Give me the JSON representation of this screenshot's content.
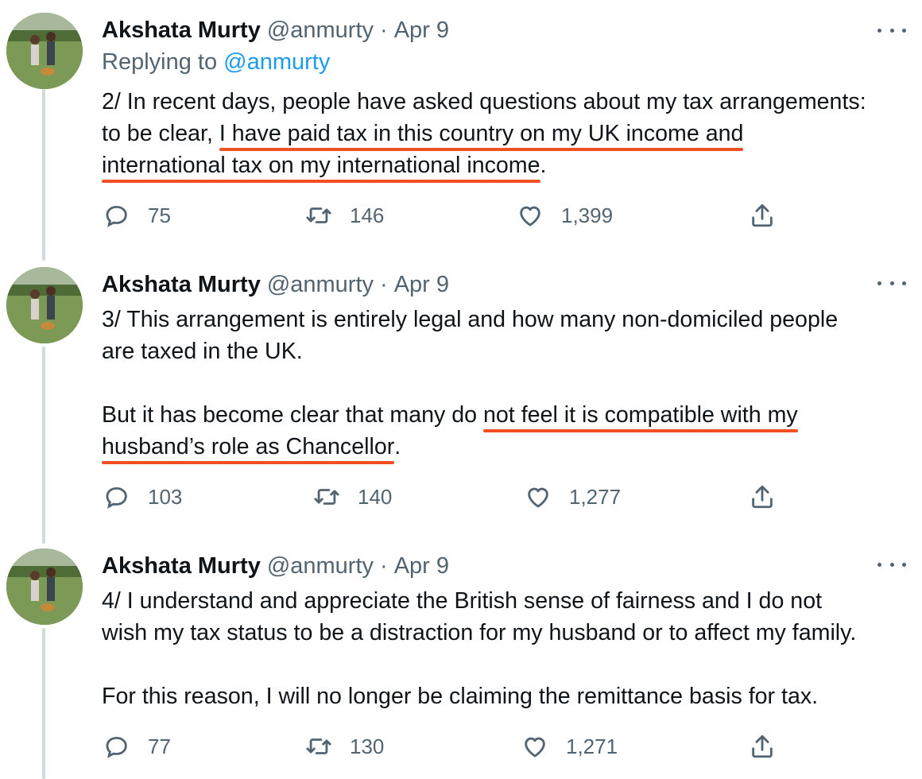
{
  "tweets": [
    {
      "display_name": "Akshata Murty",
      "handle": "@anmurty",
      "date": "Apr 9",
      "replying_prefix": "Replying to",
      "replying_handle": "@anmurty",
      "lines": [
        {
          "pre": "2/ In recent days, people have asked questions about my tax arrangements:",
          "ul": "",
          "post": ""
        },
        {
          "pre": "to be clear, ",
          "ul": "I have paid tax in this country on my UK income and",
          "post": ""
        },
        {
          "pre": "",
          "ul": "international tax on my international income",
          "post": "."
        }
      ],
      "counts": {
        "replies": "75",
        "retweets": "146",
        "likes": "1,399"
      }
    },
    {
      "display_name": "Akshata Murty",
      "handle": "@anmurty",
      "date": "Apr 9",
      "lines": [
        {
          "pre": "3/ This arrangement is entirely legal and how many non-domiciled people",
          "ul": "",
          "post": ""
        },
        {
          "pre": "are taxed in the UK.",
          "ul": "",
          "post": ""
        },
        {
          "pre": "",
          "ul": "",
          "post": ""
        },
        {
          "pre": "But it has become clear that many do ",
          "ul": "not feel it is compatible with my",
          "post": ""
        },
        {
          "pre": "",
          "ul": "husband’s role as Chancellor",
          "post": "."
        }
      ],
      "counts": {
        "replies": "103",
        "retweets": "140",
        "likes": "1,277"
      }
    },
    {
      "display_name": "Akshata Murty",
      "handle": "@anmurty",
      "date": "Apr 9",
      "lines": [
        {
          "pre": "4/ I understand and appreciate the British sense of fairness and I do not",
          "ul": "",
          "post": ""
        },
        {
          "pre": "wish my tax status to be a distraction for my husband or to affect my family.",
          "ul": "",
          "post": ""
        },
        {
          "pre": "",
          "ul": "",
          "post": ""
        },
        {
          "pre": "For this reason, I will no longer be claiming the remittance basis for tax.",
          "ul": "",
          "post": ""
        }
      ],
      "counts": {
        "replies": "77",
        "retweets": "130",
        "likes": "1,271"
      }
    }
  ],
  "icons": {
    "reply": "reply-icon",
    "retweet": "retweet-icon",
    "like": "heart-icon",
    "share": "share-icon",
    "more": "more-options-icon"
  },
  "colors": {
    "text": "#0f1419",
    "secondary": "#536471",
    "link": "#1d9bf0",
    "underline_marker": "#f04e23",
    "thread_line": "#cfd9de"
  }
}
